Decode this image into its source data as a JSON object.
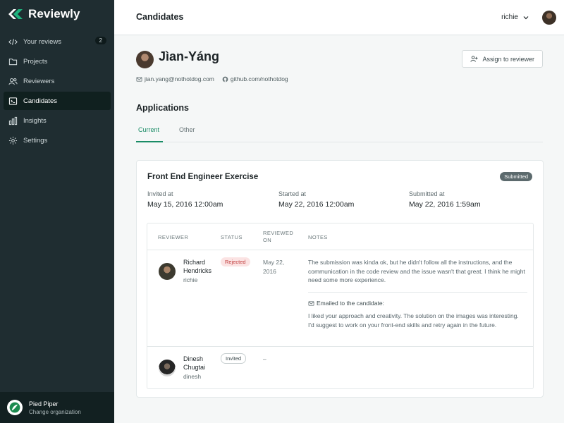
{
  "brand": {
    "name": "Reviewly",
    "accent": "#1a8c66"
  },
  "sidebar": {
    "items": [
      {
        "label": "Your reviews",
        "icon": "code-icon",
        "badge": "2"
      },
      {
        "label": "Projects",
        "icon": "folder-icon"
      },
      {
        "label": "Reviewers",
        "icon": "users-icon"
      },
      {
        "label": "Candidates",
        "icon": "terminal-icon",
        "active": true
      },
      {
        "label": "Insights",
        "icon": "bar-chart-icon"
      },
      {
        "label": "Settings",
        "icon": "gear-icon"
      }
    ],
    "org": {
      "name": "Pied Piper",
      "change_label": "Change organization"
    }
  },
  "header": {
    "title": "Candidates",
    "user": "richie"
  },
  "candidate": {
    "name": "Jìan-Yáng",
    "email": "jian.yang@nothotdog.com",
    "github": "github.com/nothotdog",
    "assign_label": "Assign to reviewer"
  },
  "applications": {
    "title": "Applications",
    "tabs": [
      {
        "label": "Current",
        "active": true
      },
      {
        "label": "Other"
      }
    ],
    "card": {
      "title": "Front End Engineer Exercise",
      "status": "Submitted",
      "invited_label": "Invited at",
      "invited_value": "May 15, 2016 12:00am",
      "started_label": "Started at",
      "started_value": "May 22, 2016 12:00am",
      "submitted_label": "Submitted at",
      "submitted_value": "May 22, 2016 1:59am",
      "columns": {
        "reviewer": "Reviewer",
        "status": "Status",
        "reviewed_on_1": "Reviewed",
        "reviewed_on_2": "on",
        "notes": "Notes"
      },
      "rows": [
        {
          "name_line1": "Richard",
          "name_line2": "Hendricks",
          "handle": "richie",
          "status": "Rejected",
          "reviewed_line1": "May 22,",
          "reviewed_line2": "2016",
          "notes": "The submission was kinda ok, but he didn't follow all the instructions, and the communication in the code review and the issue wasn't that great. I think he might need some more experience.",
          "email_label": "Emailed to the candidate:",
          "email_line1": "I liked your approach and creativity. The solution on the images was interesting.",
          "email_line2": "I'd suggest to work on your front-end skills and retry again in the future."
        },
        {
          "name_line1": "Dinesh",
          "name_line2": "Chugtai",
          "handle": "dinesh",
          "status": "Invited",
          "reviewed": "–"
        }
      ]
    }
  }
}
